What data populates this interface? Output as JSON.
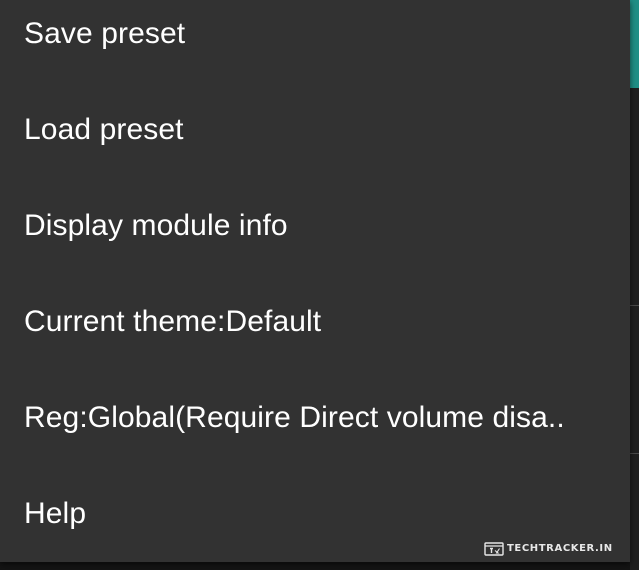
{
  "menu": {
    "items": [
      {
        "label": "Save preset"
      },
      {
        "label": "Load preset"
      },
      {
        "label": "Display module info"
      },
      {
        "label": "Current theme:Default"
      },
      {
        "label": "Reg:Global(Require Direct volume disa.."
      },
      {
        "label": "Help"
      }
    ]
  },
  "watermark": {
    "text": "TECHTRACKER.IN"
  },
  "colors": {
    "menu_background": "#323232",
    "text": "#ffffff",
    "accent": "#1f8f86"
  }
}
